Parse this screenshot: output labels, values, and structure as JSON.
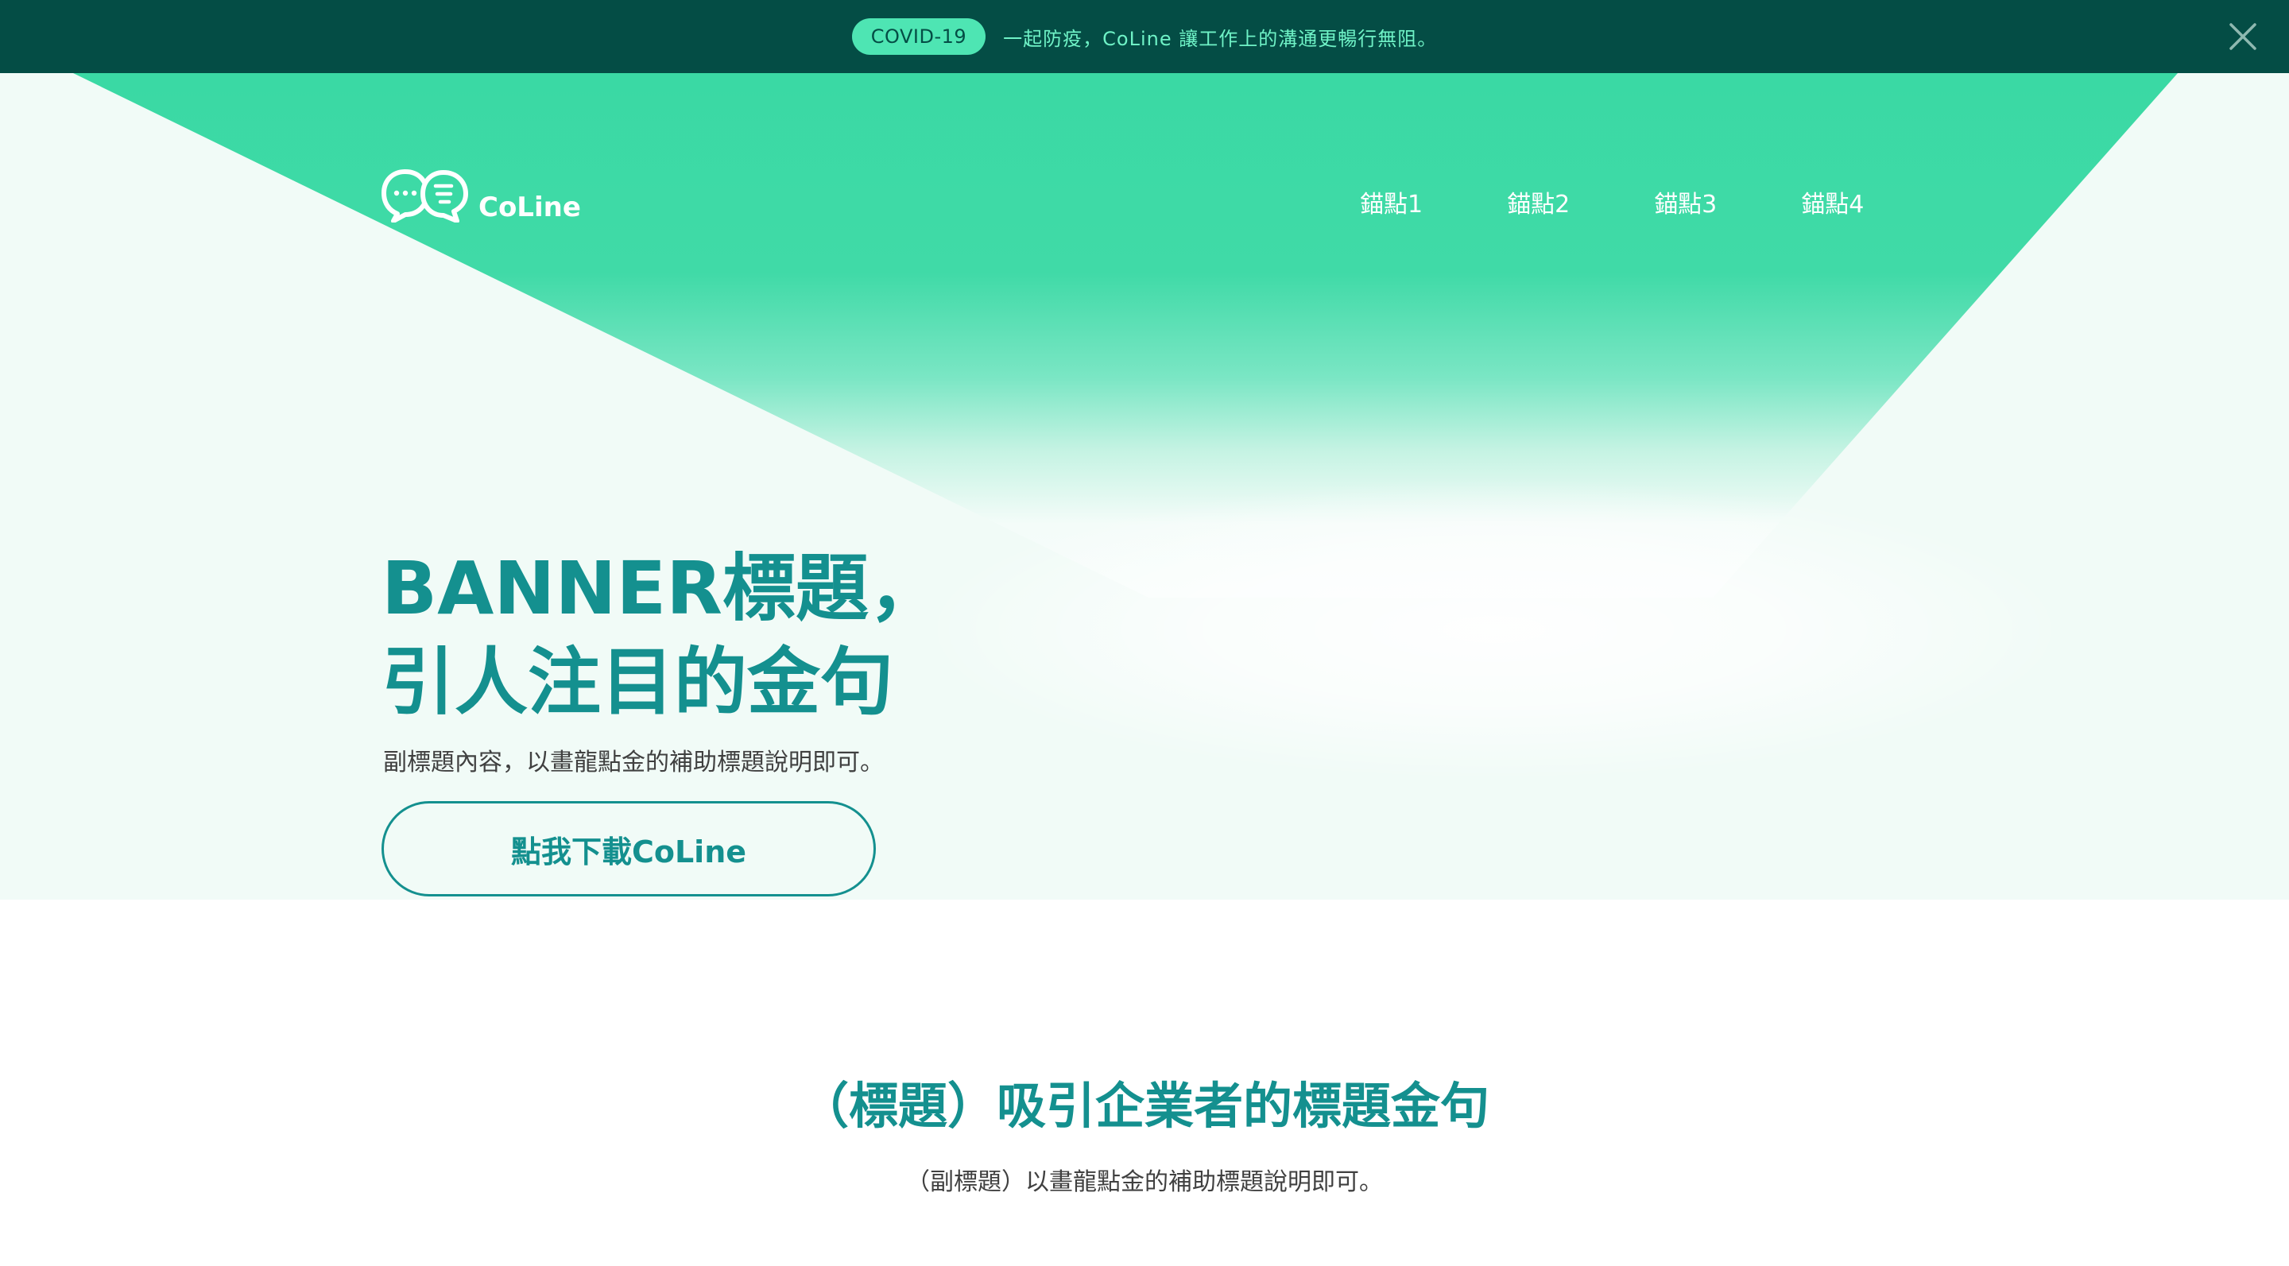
{
  "announcement": {
    "badge": "COVID-19",
    "text": "一起防疫，CoLine 讓工作上的溝通更暢行無阻。",
    "close_icon": "close-icon"
  },
  "header": {
    "logo_text": "CoLine",
    "logo_icon": "chat-bubbles-logo",
    "nav": [
      {
        "label": "錨點1"
      },
      {
        "label": "錨點2"
      },
      {
        "label": "錨點3"
      },
      {
        "label": "錨點4"
      }
    ]
  },
  "hero": {
    "title_line1": "BANNER標題，",
    "title_line2": "引人注目的金句",
    "subtitle": "副標題內容，以畫龍點金的補助標題說明即可。",
    "cta_label": "點我下載CoLine"
  },
  "section": {
    "title": "（標題）吸引企業者的標題金句",
    "subtitle": "（副標題）以畫龍點金的補助標題說明即可。"
  },
  "colors": {
    "announce_bg": "#044d45",
    "badge_bg": "#4ee5b3",
    "brand_green": "#3ad9a4",
    "primary_teal": "#14908f",
    "hero_bg": "#f1fbf7"
  }
}
